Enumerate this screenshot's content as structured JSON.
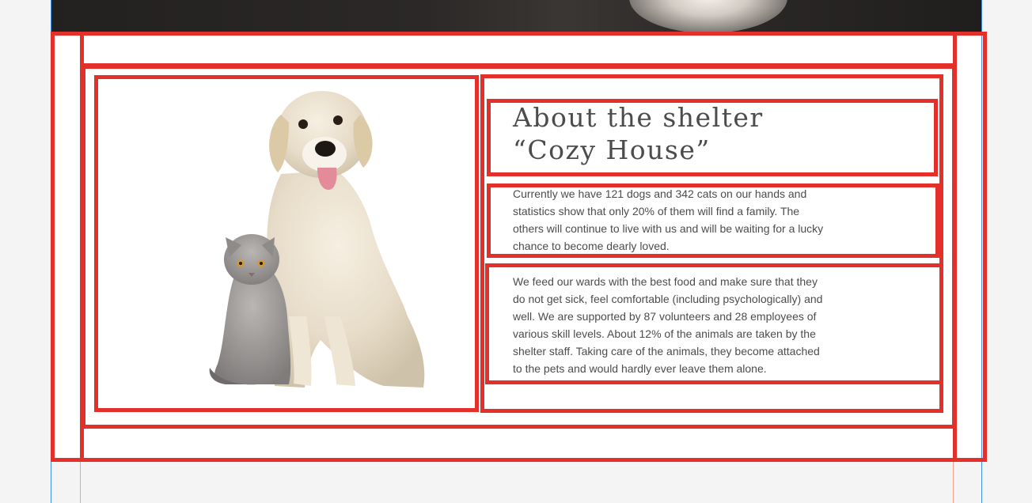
{
  "about": {
    "title_line1": "About the shelter",
    "title_line2": "“Cozy House”",
    "paragraphs": [
      "Currently we have 121 dogs and 342 cats on our hands and statistics show that only 20% of them will find a family. The others will continue to live with us and will be waiting for a lucky chance to become dearly loved.",
      "We feed our wards with the best food and make sure that they do not get sick, feel comfortable (including psychologically) and well. We are supported by 87 volunteers and 28 employees of various skill levels. About 12% of the animals are taken by the shelter staff. Taking care of the animals, they become attached to the pets and would hardly ever leave them alone."
    ]
  },
  "colors": {
    "overlay_outline": "#e3302a",
    "text": "#4c4c4c",
    "guide_blue": "#3d8fe8",
    "guide_red": "#f2a08f"
  },
  "icons": {
    "illustration": "dog-and-cat-illustration"
  }
}
